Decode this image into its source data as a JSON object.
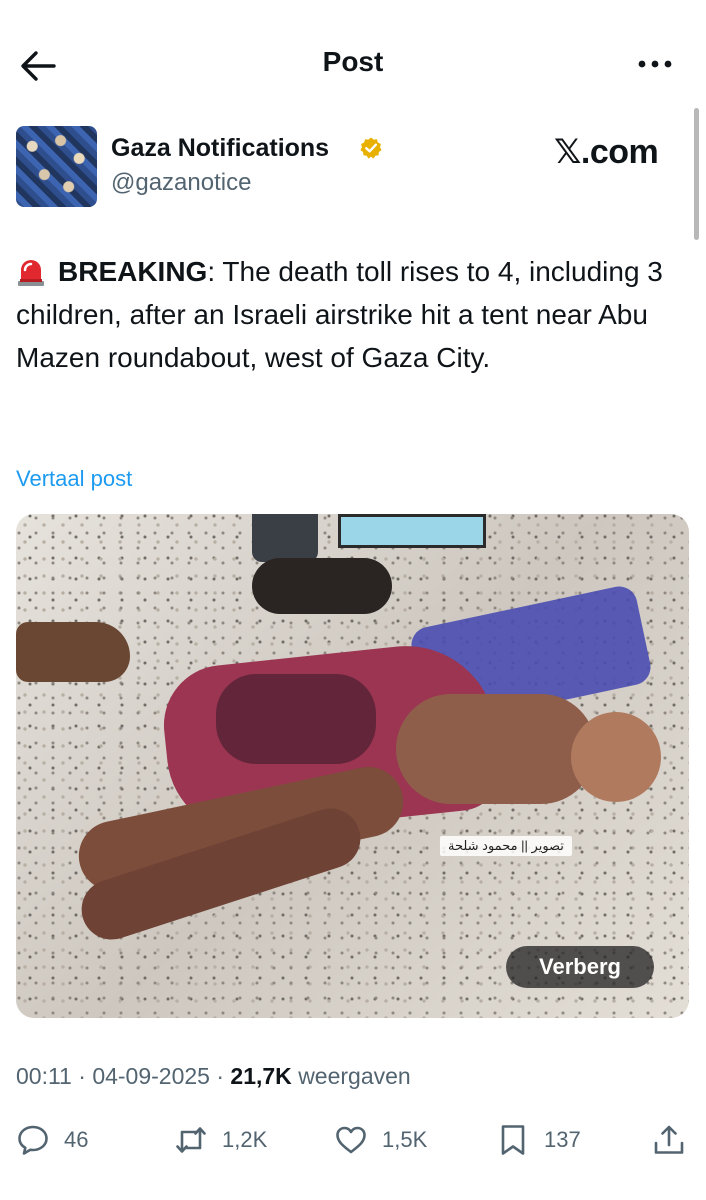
{
  "header": {
    "title": "Post",
    "back_icon": "arrow-left-icon",
    "more_icon": "more-horizontal-icon"
  },
  "author": {
    "name": "Gaza Notifications",
    "handle": "@gazanotice",
    "verified_color": "#e8b100",
    "avatar_icon": "crowd-photo-avatar"
  },
  "brand": {
    "label": "𝕏.com"
  },
  "tweet": {
    "emoji_icon": "rotating-light-siren-icon",
    "lead": "BREAKING",
    "body": ": The death toll rises to 4, including 3 children, after an Israeli airstrike hit a tent near Abu Mazen roundabout, west of Gaza City."
  },
  "translate_label": "Vertaal post",
  "media": {
    "watermark": "تصوير || محمود شلحة",
    "hide_label": "Verberg"
  },
  "meta": {
    "time": "00:11",
    "date": "04-09-2025",
    "views": "21,7K",
    "views_label": "weergaven",
    "separator": "·"
  },
  "actions": {
    "replies": "46",
    "reposts": "1,2K",
    "likes": "1,5K",
    "bookmarks": "137"
  },
  "colors": {
    "text": "#0f1419",
    "secondary": "#536471",
    "link": "#1d9bf0",
    "background": "#ffffff"
  }
}
